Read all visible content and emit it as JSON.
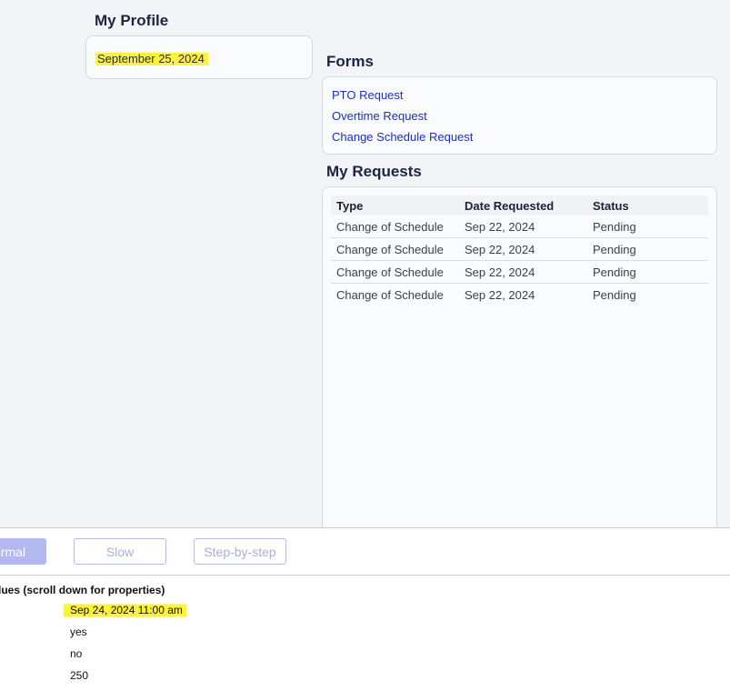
{
  "profile": {
    "title": "My Profile",
    "date": "September 25, 2024"
  },
  "forms": {
    "title": "Forms",
    "links": [
      "PTO Request",
      "Overtime Request",
      "Change Schedule Request"
    ]
  },
  "requests": {
    "title": "My Requests",
    "columns": [
      "Type",
      "Date Requested",
      "Status"
    ],
    "rows": [
      [
        "Change of Schedule",
        "Sep 22, 2024",
        "Pending"
      ],
      [
        "Change of Schedule",
        "Sep 22, 2024",
        "Pending"
      ],
      [
        "Change of Schedule",
        "Sep 22, 2024",
        "Pending"
      ],
      [
        "Change of Schedule",
        "Sep 22, 2024",
        "Pending"
      ]
    ]
  },
  "speed": {
    "normal_label": "Normal",
    "slow_label": "Slow",
    "step_label": "Step-by-step"
  },
  "values": {
    "heading": "Values (scroll down for properties)",
    "items": [
      "Sep 24, 2024 11:00 am",
      "yes",
      "no",
      "250"
    ]
  },
  "colors": {
    "link": "#1f2fb8",
    "highlight": "#fff23a",
    "accent_button": "#b3b8f0",
    "app_background": "#f3f4f8"
  }
}
